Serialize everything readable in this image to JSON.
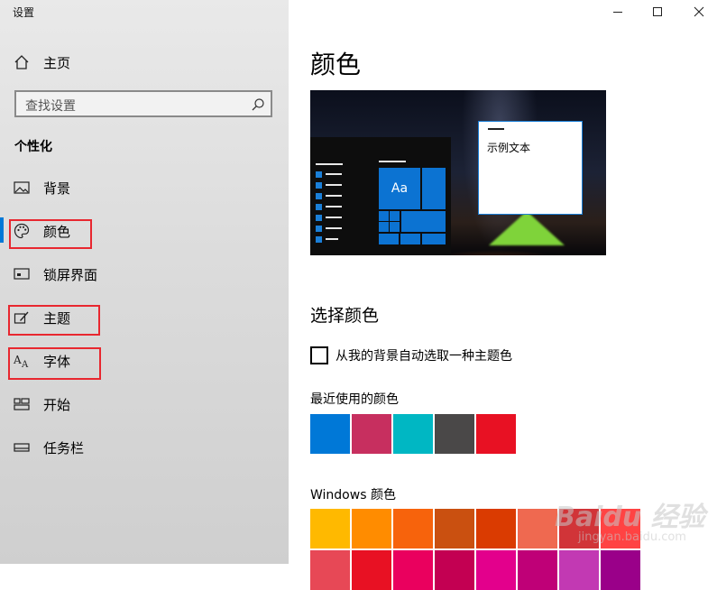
{
  "window": {
    "title": "设置"
  },
  "sidebar": {
    "home_label": "主页",
    "search_placeholder": "查找设置",
    "section_title": "个性化",
    "items": [
      {
        "label": "背景",
        "icon": "image-icon"
      },
      {
        "label": "颜色",
        "icon": "palette-icon",
        "active": true
      },
      {
        "label": "锁屏界面",
        "icon": "lock-screen-icon"
      },
      {
        "label": "主题",
        "icon": "theme-brush-icon"
      },
      {
        "label": "字体",
        "icon": "font-icon"
      },
      {
        "label": "开始",
        "icon": "start-icon"
      },
      {
        "label": "任务栏",
        "icon": "taskbar-icon"
      }
    ]
  },
  "main": {
    "title": "颜色",
    "preview_sample_text": "示例文本",
    "preview_tile_text": "Aa",
    "choose_color_title": "选择颜色",
    "auto_pick_label": "从我的背景自动选取一种主题色",
    "auto_pick_checked": false,
    "recent_colors_title": "最近使用的颜色",
    "recent_colors": [
      "#0078d7",
      "#c72f5f",
      "#00b7c3",
      "#4a4848",
      "#e81123"
    ],
    "windows_colors_title": "Windows 颜色",
    "windows_colors_row1": [
      "#ffb900",
      "#ff8c00",
      "#f7630c",
      "#ca5010",
      "#da3b01",
      "#ef6950",
      "#d13438",
      "#ff4343"
    ],
    "windows_colors_row2": [
      "#e74856",
      "#e81123",
      "#ea005e",
      "#c30052",
      "#e3008c",
      "#bf0077",
      "#c239b3",
      "#9a0089"
    ]
  },
  "watermark": {
    "brand": "Baidu 经验",
    "url": "jingyan.baidu.com"
  },
  "colors": {
    "accent": "#0078d7",
    "highlight_box": "#e8272f"
  }
}
